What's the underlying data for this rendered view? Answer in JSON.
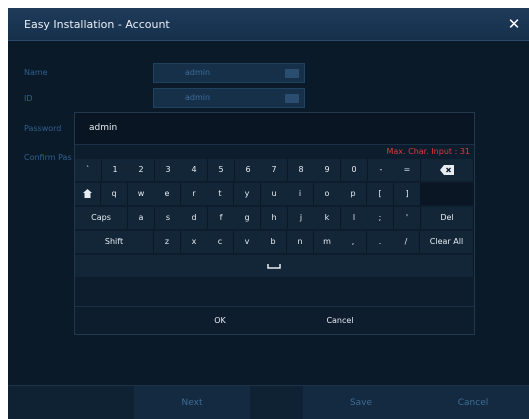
{
  "window": {
    "title": "Easy Installation - Account",
    "close_symbol": "✕"
  },
  "form": {
    "name_label": "Name",
    "name_value": "admin",
    "id_label": "ID",
    "id_value": "admin",
    "password_label": "Password",
    "confirm_label": "Confirm Pas"
  },
  "keyboard": {
    "input_value": "admin",
    "max_char": "Max. Char. Input : 31",
    "row1": [
      "`",
      "1",
      "2",
      "3",
      "4",
      "5",
      "6",
      "7",
      "8",
      "9",
      "0",
      "-",
      "="
    ],
    "row2": [
      "q",
      "w",
      "e",
      "r",
      "t",
      "y",
      "u",
      "i",
      "o",
      "p",
      "[",
      "]"
    ],
    "row3_caps": "Caps",
    "row3": [
      "a",
      "s",
      "d",
      "f",
      "g",
      "h",
      "j",
      "k",
      "l",
      ";",
      "'"
    ],
    "row3_del": "Del",
    "row4_shift": "Shift",
    "row4": [
      "z",
      "x",
      "c",
      "v",
      "b",
      "n",
      "m",
      ",",
      ".",
      "/"
    ],
    "row4_clear": "Clear All",
    "ok": "OK",
    "cancel": "Cancel"
  },
  "bottom": {
    "next": "Next",
    "save": "Save",
    "cancel": "Cancel"
  },
  "icons": {
    "backspace": "backspace-icon",
    "home": "home-icon",
    "space": "space-icon"
  },
  "colors": {
    "background": "#0b1a29",
    "titlebar": "#1f3b5a",
    "warning": "#e0383b"
  }
}
